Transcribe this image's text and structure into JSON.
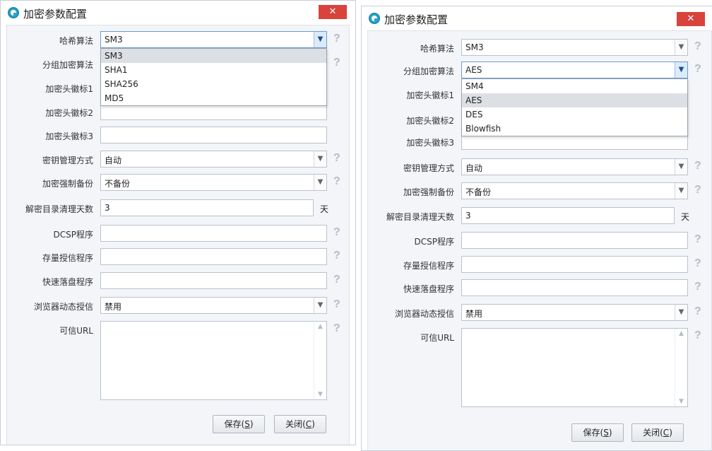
{
  "dialog_title": "加密参数配置",
  "close_glyph": "✕",
  "labels": {
    "hash": "哈希算法",
    "block": "分组加密算法",
    "header1": "加密头徽标1",
    "header2": "加密头徽标2",
    "header3": "加密头徽标3",
    "key_mgmt": "密钥管理方式",
    "backup": "加密强制备份",
    "cleanup_days": "解密目录清理天数",
    "dcsp": "DCSP程序",
    "stock_auth": "存量授信程序",
    "fast_flush": "快速落盘程序",
    "browser_auth": "浏览器动态授信",
    "trusted_url": "可信URL"
  },
  "values": {
    "hash": "SM3",
    "block": "AES",
    "key_mgmt": "自动",
    "backup": "不备份",
    "cleanup_days": "3",
    "browser_auth": "禁用"
  },
  "unit_days": "天",
  "help_glyph": "?",
  "hash_options": [
    "SM3",
    "SHA1",
    "SHA256",
    "MD5"
  ],
  "block_options": [
    "SM4",
    "AES",
    "DES",
    "Blowfish"
  ],
  "buttons": {
    "save_text": "保存(",
    "save_key": "S",
    "close_text": "关闭(",
    "close_key": "C",
    "suffix": ")"
  },
  "icons": {
    "dropdown": "chevron-down-icon",
    "help": "question-mark-icon",
    "app": "app-logo-icon",
    "close": "close-icon"
  },
  "colors": {
    "close_button": "#d8433b",
    "panel": "#f3f5f8",
    "selected_option": "#dcdfe3"
  }
}
